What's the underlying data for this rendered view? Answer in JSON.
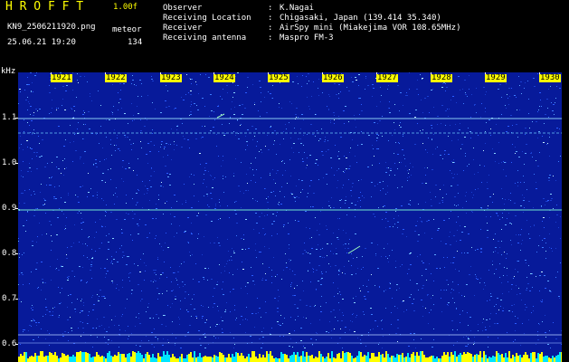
{
  "header": {
    "brand": "H R O F F T",
    "version": "1.00f",
    "filename": "KN9_2506211920.png",
    "detector": "meteor",
    "datetime": "25.06.21 19:20",
    "count": "134"
  },
  "info": [
    {
      "label": "Observer",
      "sep": ":",
      "value": "K.Nagai"
    },
    {
      "label": "Receiving Location",
      "sep": ":",
      "value": "Chigasaki, Japan (139.414 35.340)"
    },
    {
      "label": "Receiver",
      "sep": ":",
      "value": "AirSpy mini (Miakejima VOR 108.65MHz)"
    },
    {
      "label": "Receiving antenna",
      "sep": ":",
      "value": "Maspro FM-3"
    }
  ],
  "axis": {
    "y_unit": "kHz",
    "y_ticks": [
      "1.1",
      "1.0",
      "0.9",
      "0.8",
      "0.7",
      "0.6"
    ],
    "x_ticks": [
      "1921",
      "1922",
      "1923",
      "1924",
      "1925",
      "1926",
      "1927",
      "1928",
      "1929",
      "1930"
    ]
  },
  "colors": {
    "background": "#000000",
    "plot_background": "#071a9a",
    "accent": "#ffff00",
    "trace": "#7fffd4",
    "text": "#ffffff"
  }
}
